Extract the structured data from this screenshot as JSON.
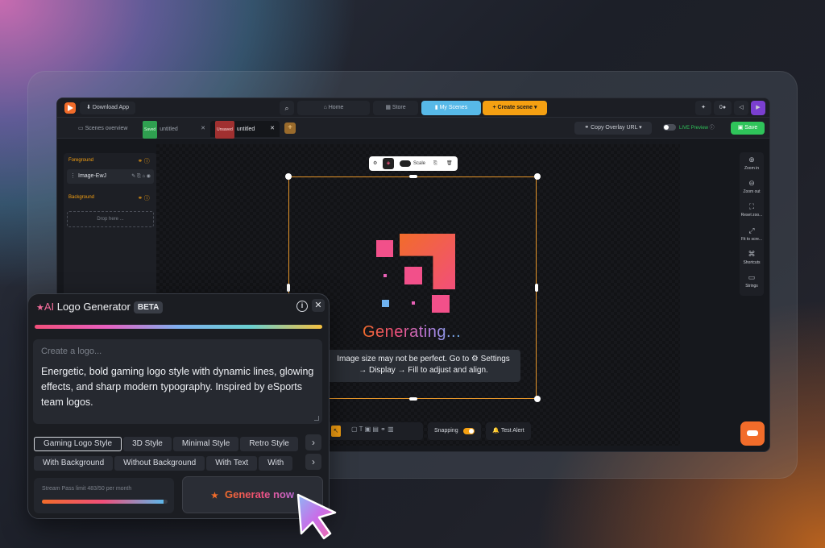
{
  "topbar": {
    "download_app": "Download App",
    "home": "Home",
    "store": "Store",
    "my_scenes": "My Scenes",
    "create_scene": "+ Create scene",
    "coins": "0"
  },
  "tabs": {
    "overview": "Scenes overview",
    "tab1_tag": "Saved",
    "tab1_label": "untitled",
    "tab2_tag": "Unsaved",
    "tab2_label": "untitled",
    "add": "+",
    "copy_overlay_url": "Copy Overlay URL",
    "live_preview": "LIVE Preview",
    "save": "Save"
  },
  "layers": {
    "foreground": "Foreground",
    "image_layer": "Image-EwJ",
    "background": "Background",
    "drop_here": "Drop here ..."
  },
  "canvas": {
    "scale_label": "Scale",
    "generating": "Generating...",
    "notice_line1": "Image size may not be perfect. Go to ⚙ Settings",
    "notice_line2": "→ Display → Fill to adjust and align."
  },
  "bottom_toolbar": {
    "snapping": "Snapping",
    "test_alert": "Test Alert"
  },
  "right_panel": [
    {
      "label": "Zoom in",
      "icon": "zoom-in-icon"
    },
    {
      "label": "Zoom out",
      "icon": "zoom-out-icon"
    },
    {
      "label": "Reset zoo...",
      "icon": "reset-zoom-icon"
    },
    {
      "label": "Fit to scre...",
      "icon": "fit-screen-icon"
    },
    {
      "label": "Shortcuts",
      "icon": "shortcuts-icon"
    },
    {
      "label": "Strings",
      "icon": "strings-icon"
    }
  ],
  "generator": {
    "title_ai": "AI",
    "title_rest": " Logo Generator",
    "beta": "BETA",
    "placeholder": "Create a logo...",
    "prompt": "Energetic, bold gaming logo style with dynamic lines, glowing effects, and sharp modern typography. Inspired by eSports team logos.",
    "styles": [
      "Gaming Logo Style",
      "3D Style",
      "Minimal Style",
      "Retro Style"
    ],
    "options": [
      "With Background",
      "Without Background",
      "With Text",
      "With"
    ],
    "usage_text": "Stream Pass limit 483/50 per month",
    "usage_fraction": 0.97,
    "generate": "Generate now"
  },
  "colors": {
    "accent_orange": "#f26c2a",
    "accent_pink": "#f24f7a",
    "accent_blue": "#57b9e8",
    "save_green": "#2fc45a"
  }
}
